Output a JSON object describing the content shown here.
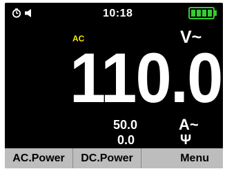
{
  "status_bar": {
    "time": "10:18",
    "battery_level": 1.0,
    "battery_color": "#33cc33",
    "icons": [
      "timer-icon",
      "speaker-icon",
      "battery-icon"
    ]
  },
  "display": {
    "mode": "AC",
    "mode_color": "#f5e800",
    "primary_value": "110.0",
    "primary_unit": "V~",
    "secondary_value_1": "50.0",
    "secondary_value_2": "0.0",
    "secondary_unit_1": "A~",
    "secondary_unit_2": "Ψ"
  },
  "softkeys": {
    "ac_power": "AC.Power",
    "dc_power": "DC.Power",
    "menu": "Menu"
  }
}
